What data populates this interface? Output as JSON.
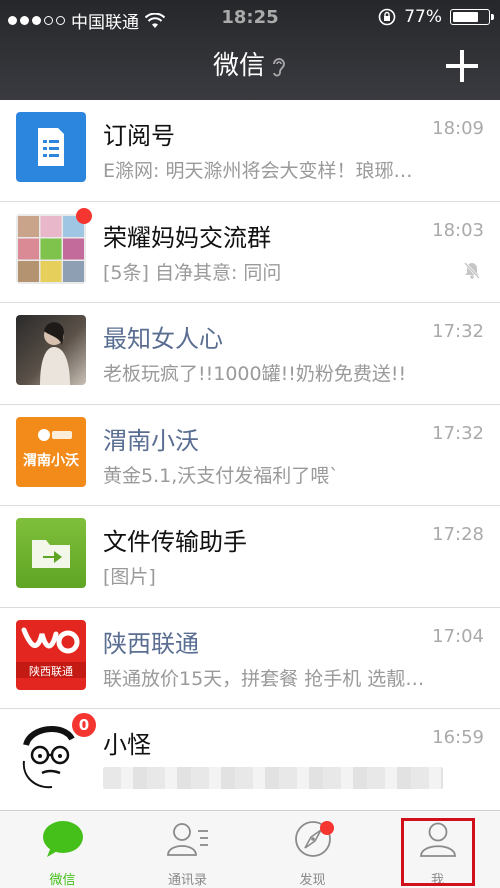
{
  "status": {
    "carrier": "中国联通",
    "time": "18:25",
    "battery": "77%",
    "battery_level": 0.77
  },
  "header": {
    "title": "微信"
  },
  "chats": [
    {
      "name": "订阅号",
      "time": "18:09",
      "preview": "E滁网: 明天滁州将会大变样！琅琊…",
      "kind": "normal"
    },
    {
      "name": "荣耀妈妈交流群",
      "time": "18:03",
      "preview": "[5条] 自净其意: 同问",
      "kind": "normal",
      "muted": true,
      "dot": true
    },
    {
      "name": "最知女人心",
      "time": "17:32",
      "preview": "老板玩疯了!!1000罐!!奶粉免费送!!",
      "kind": "service"
    },
    {
      "name": "渭南小沃",
      "time": "17:32",
      "preview": "黄金5.1,沃支付发福利了喂`",
      "kind": "service",
      "avatar_text": "渭南小沃"
    },
    {
      "name": "文件传输助手",
      "time": "17:28",
      "preview": "[图片]",
      "kind": "normal"
    },
    {
      "name": "陕西联通",
      "time": "17:04",
      "preview": "联通放价15天，拼套餐 抢手机 选靓…",
      "kind": "service",
      "avatar_text": "陕西联通"
    },
    {
      "name": "小怪",
      "time": "16:59",
      "preview": "",
      "kind": "normal",
      "badge": "0"
    }
  ],
  "tabs": [
    {
      "label": "微信",
      "active": true
    },
    {
      "label": "通讯录"
    },
    {
      "label": "发现",
      "dot": true
    },
    {
      "label": "我"
    }
  ],
  "colors": {
    "accent": "#45c01a",
    "badge": "#f43530",
    "service_name": "#5a6e92"
  }
}
